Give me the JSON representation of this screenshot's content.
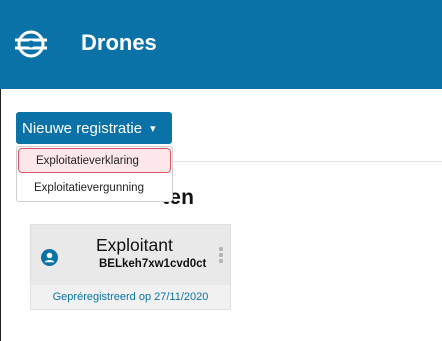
{
  "app": {
    "title": "Drones",
    "logo_icon": "drone-agency-logo-icon",
    "brand_color": "#0b72a8"
  },
  "registration": {
    "button_label": "Nieuwe registratie",
    "caret_glyph": "▾",
    "dropdown_items": [
      {
        "label": "Exploitatieverklaring",
        "highlighted": true
      },
      {
        "label": "Exploitatievergunning",
        "highlighted": false
      }
    ]
  },
  "certificates": {
    "section_title_visible_tail": "ten",
    "cards": [
      {
        "role": "Exploitant",
        "id": "BELkeh7xw1cvd0ct",
        "status": "Gepréregistreerd op 27/11/2020",
        "avatar_icon": "user-avatar-icon",
        "menu_icon": "more-vertical-icon"
      }
    ]
  }
}
